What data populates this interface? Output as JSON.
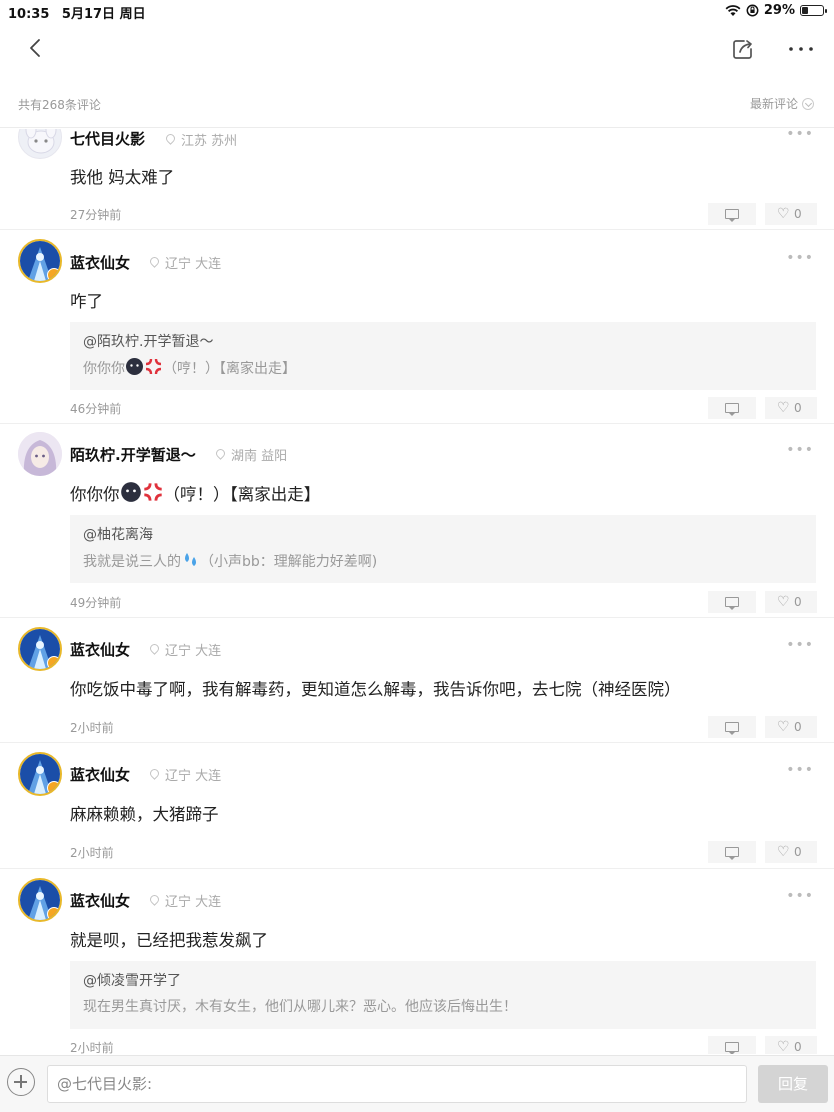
{
  "status_bar": {
    "time": "10:35",
    "date": "5月17日 周日",
    "battery": "29%",
    "battery_level": 0.29
  },
  "header": {
    "comment_count": "共有268条评论",
    "sort_label": "最新评论"
  },
  "comments": [
    {
      "username": "七代目火影",
      "location": "江苏  苏州",
      "content": "我他 妈太难了",
      "time": "27分钟前",
      "likes": "0"
    },
    {
      "username": "蓝衣仙女",
      "location": "辽宁  大连",
      "content": "咋了",
      "quote_user": "@陌玖柠.开学暂退～",
      "quote_text_a": "你你你",
      "quote_text_b": "（哼！）【离家出走】",
      "time": "46分钟前",
      "likes": "0"
    },
    {
      "username": "陌玖柠.开学暂退～",
      "location": "湖南  益阳",
      "content_a": "你你你",
      "content_b": "（哼！）【离家出走】",
      "quote_user": "@柚花离海",
      "quote_text_a": "我就是说三人的",
      "quote_text_b": "（小声bb：理解能力好差啊)",
      "time": "49分钟前",
      "likes": "0"
    },
    {
      "username": "蓝衣仙女",
      "location": "辽宁  大连",
      "content": "你吃饭中毒了啊，我有解毒药，更知道怎么解毒，我告诉你吧，去七院（神经医院）",
      "time": "2小时前",
      "likes": "0"
    },
    {
      "username": "蓝衣仙女",
      "location": "辽宁  大连",
      "content": "麻麻赖赖，大猪蹄子",
      "time": "2小时前",
      "likes": "0"
    },
    {
      "username": "蓝衣仙女",
      "location": "辽宁  大连",
      "content": "就是呗，已经把我惹发飙了",
      "quote_user": "@倾凌雪开学了",
      "quote_text": "现在男生真讨厌，木有女生，他们从哪儿来？恶心。他应该后悔出生！",
      "time": "2小时前",
      "likes": "0"
    }
  ],
  "reply_bar": {
    "placeholder": "@七代目火影:",
    "send_label": "回复"
  },
  "icons": {
    "back": "chevron-left-icon",
    "share": "share-icon",
    "more": "more-icon",
    "reply": "comment-bubble-icon",
    "like": "heart-icon",
    "location": "location-pin-icon",
    "add": "plus-circle-icon"
  },
  "colors": {
    "avatar_ring": "#e8b82a",
    "badge": "#f5a623",
    "send_disabled": "#d4d4d4"
  }
}
